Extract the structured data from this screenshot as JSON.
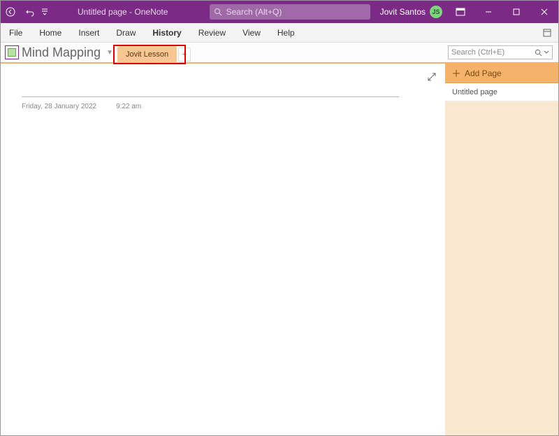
{
  "titlebar": {
    "title": "Untitled page  -  OneNote",
    "search_placeholder": "Search (Alt+Q)",
    "user_name": "Jovit Santos",
    "user_initials": "JS"
  },
  "ribbon": {
    "file": "File",
    "home": "Home",
    "insert": "Insert",
    "draw": "Draw",
    "history": "History",
    "review": "Review",
    "view": "View",
    "help": "Help"
  },
  "notebook": {
    "name": "Mind Mapping",
    "section_tab": "Jovit Lesson",
    "search_placeholder": "Search (Ctrl+E)"
  },
  "page": {
    "date": "Friday, 28 January 2022",
    "time": "9:22 am"
  },
  "right_panel": {
    "add_page": "Add Page",
    "page_1": "Untitled page"
  }
}
